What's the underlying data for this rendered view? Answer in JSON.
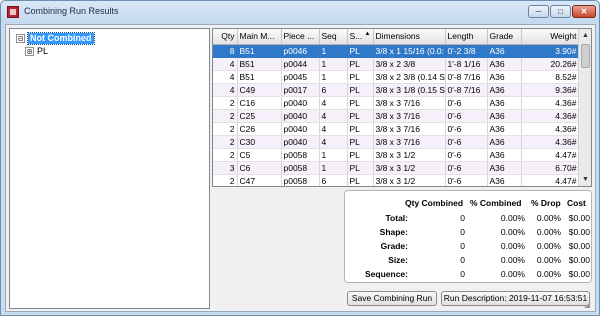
{
  "window": {
    "title": "Combining Run Results",
    "minimize_glyph": "─",
    "maximize_glyph": "□",
    "close_glyph": "✕"
  },
  "tree": {
    "root": {
      "label": "Not Combined",
      "expander": "⊟"
    },
    "child": {
      "label": "PL",
      "expander": "⊞"
    }
  },
  "grid": {
    "columns": [
      "Qty",
      "Main M...",
      "Piece ...",
      "Seq",
      "S...",
      "Dimensions",
      "Length",
      "Grade",
      "Weight"
    ],
    "sort_indicator": "▲",
    "rows": [
      [
        "8",
        "B51",
        "p0046",
        "1",
        "PL",
        "3/8 x 1 15/16  (0.0:",
        "0'-2 3/8",
        "A36",
        "3.90#"
      ],
      [
        "4",
        "B51",
        "p0044",
        "1",
        "PL",
        "3/8 x 2 3/8",
        "1'-8 1/16",
        "A36",
        "20.26#"
      ],
      [
        "4",
        "B51",
        "p0045",
        "1",
        "PL",
        "3/8 x 2 3/8  (0.14 S",
        "0'-8 7/16",
        "A36",
        "8.52#"
      ],
      [
        "4",
        "C49",
        "p0017",
        "6",
        "PL",
        "3/8 x 3 1/8  (0.15 S",
        "0'-8 7/16",
        "A36",
        "9.36#"
      ],
      [
        "2",
        "C16",
        "p0040",
        "4",
        "PL",
        "3/8 x 3 7/16",
        "0'-6",
        "A36",
        "4.36#"
      ],
      [
        "2",
        "C25",
        "p0040",
        "4",
        "PL",
        "3/8 x 3 7/16",
        "0'-6",
        "A36",
        "4.36#"
      ],
      [
        "2",
        "C26",
        "p0040",
        "4",
        "PL",
        "3/8 x 3 7/16",
        "0'-6",
        "A36",
        "4.36#"
      ],
      [
        "2",
        "C30",
        "p0040",
        "4",
        "PL",
        "3/8 x 3 7/16",
        "0'-6",
        "A36",
        "4.36#"
      ],
      [
        "2",
        "C5",
        "p0058",
        "1",
        "PL",
        "3/8 x 3 1/2",
        "0'-6",
        "A36",
        "4.47#"
      ],
      [
        "3",
        "C6",
        "p0058",
        "1",
        "PL",
        "3/8 x 3 1/2",
        "0'-6",
        "A36",
        "6.70#"
      ],
      [
        "2",
        "C47",
        "p0058",
        "6",
        "PL",
        "3/8 x 3 1/2",
        "0'-6",
        "A36",
        "4.47#"
      ]
    ],
    "scroll_up": "▲",
    "scroll_down": "▼"
  },
  "summary": {
    "headers": [
      "Qty Combined",
      "% Combined",
      "% Drop",
      "Cost"
    ],
    "rows": [
      {
        "label": "Total:",
        "qty": "0",
        "pct_combined": "0.00%",
        "pct_drop": "0.00%",
        "cost": "$0.00"
      },
      {
        "label": "Shape:",
        "qty": "0",
        "pct_combined": "0.00%",
        "pct_drop": "0.00%",
        "cost": "$0.00"
      },
      {
        "label": "Grade:",
        "qty": "0",
        "pct_combined": "0.00%",
        "pct_drop": "0.00%",
        "cost": "$0.00"
      },
      {
        "label": "Size:",
        "qty": "0",
        "pct_combined": "0.00%",
        "pct_drop": "0.00%",
        "cost": "$0.00"
      },
      {
        "label": "Sequence:",
        "qty": "0",
        "pct_combined": "0.00%",
        "pct_drop": "0.00%",
        "cost": "$0.00"
      }
    ]
  },
  "buttons": {
    "save": "Save Combining Run",
    "run_description": "Run Description: 2019-11-07 16:53:51"
  },
  "colors": {
    "selection": "#3078c8",
    "tree_selection": "#3399ff",
    "alt_row": "#f6f0fa"
  }
}
